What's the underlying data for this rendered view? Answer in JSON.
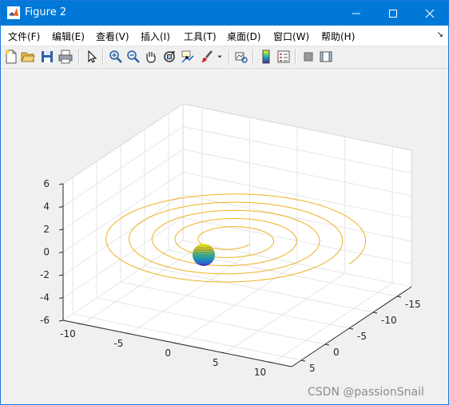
{
  "window": {
    "title": "Figure 2"
  },
  "menu": [
    "文件(F)",
    "编辑(E)",
    "查看(V)",
    "插入(I)",
    "工具(T)",
    "桌面(D)",
    "窗口(W)",
    "帮助(H)"
  ],
  "toolbar": [
    {
      "name": "new-figure-button",
      "icon": "new-file-icon"
    },
    {
      "name": "open-file-button",
      "icon": "folder-open-icon"
    },
    {
      "name": "save-figure-button",
      "icon": "save-icon"
    },
    {
      "name": "print-figure-button",
      "icon": "printer-icon"
    },
    {
      "name": "edit-plot-button",
      "icon": "cursor-arrow-icon"
    },
    {
      "name": "zoom-in-button",
      "icon": "zoom-in-icon"
    },
    {
      "name": "zoom-out-button",
      "icon": "zoom-out-icon"
    },
    {
      "name": "pan-button",
      "icon": "hand-icon"
    },
    {
      "name": "rotate-3d-button",
      "icon": "rotate-3d-icon"
    },
    {
      "name": "data-cursor-button",
      "icon": "data-cursor-icon"
    },
    {
      "name": "brush-button",
      "icon": "brush-icon"
    },
    {
      "name": "link-plot-button",
      "icon": "link-plot-icon"
    },
    {
      "name": "insert-colorbar-button",
      "icon": "colorbar-icon"
    },
    {
      "name": "insert-legend-button",
      "icon": "legend-icon"
    },
    {
      "name": "hide-plot-tools-button",
      "icon": "hide-tools-icon"
    },
    {
      "name": "show-plot-tools-button",
      "icon": "show-tools-icon"
    }
  ],
  "chart_data": {
    "type": "line",
    "plot_kind": "3d spiral trajectory around a sphere",
    "x_axis": {
      "ticks": [
        "-10",
        "-5",
        "0",
        "5",
        "10"
      ],
      "range": [
        -12,
        12
      ]
    },
    "y_axis": {
      "ticks": [
        "-15",
        "-10",
        "-5",
        "0",
        "5"
      ],
      "range": [
        -18,
        7
      ]
    },
    "z_axis": {
      "ticks": [
        "-6",
        "-4",
        "-2",
        "0",
        "2",
        "4",
        "6"
      ],
      "range": [
        -6,
        6
      ]
    },
    "grid": true,
    "series": [
      {
        "kind": "spiral curve",
        "color": "#EDB120",
        "approx_max_radius": 16,
        "turns": 5,
        "plane_z": 0
      },
      {
        "kind": "sphere surface",
        "colormap": "parula",
        "radius": 2,
        "center": [
          0,
          0,
          0
        ]
      }
    ]
  },
  "watermark": "CSDN @passionSnail"
}
